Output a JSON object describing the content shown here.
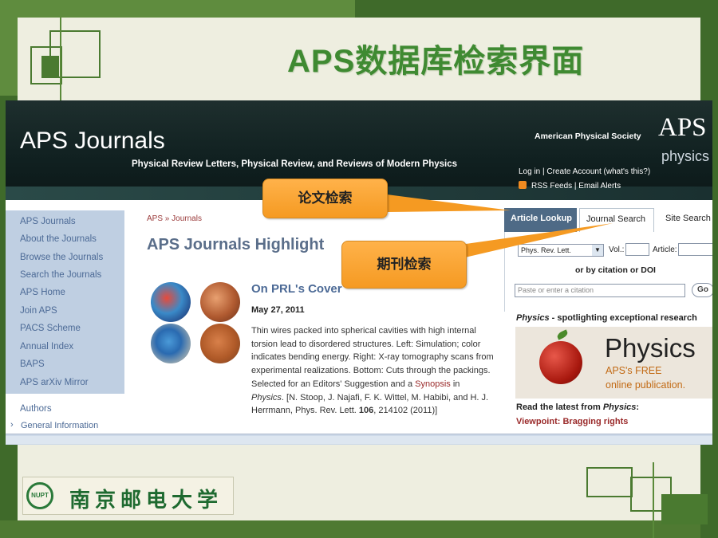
{
  "slide": {
    "title": "APS数据库检索界面",
    "university": "南京邮电大学",
    "seal_text": "NUPT"
  },
  "header": {
    "brand": "APS Journals",
    "tagline": "Physical Review Letters, Physical Review, and Reviews of Modern Physics",
    "society": "American Physical Society",
    "logo_aps": "APS",
    "logo_physics": "physics",
    "links_line1": "Log in  |  Create Account (what's this?)",
    "rss": "RSS Feeds",
    "email": "Email Alerts"
  },
  "sidebar": {
    "items": [
      {
        "label": "APS Journals"
      },
      {
        "label": "About the Journals"
      },
      {
        "label": "Browse the Journals"
      },
      {
        "label": "Search the Journals"
      },
      {
        "label": "APS Home"
      },
      {
        "label": "Join APS"
      },
      {
        "label": "PACS Scheme"
      },
      {
        "label": "Annual Index"
      },
      {
        "label": "BAPS"
      },
      {
        "label": "APS arXiv Mirror"
      }
    ],
    "authors": "Authors",
    "general_info": "General Information"
  },
  "main": {
    "breadcrumb_home": "APS",
    "breadcrumb_sep": "»",
    "breadcrumb_current": "Journals",
    "title": "APS Journals Highlight",
    "article_heading": "On PRL's Cover",
    "article_date": "May 27, 2011",
    "article_text1": "Thin wires packed into spherical cavities with high internal torsion lead to disordered structures. Left: Simulation; color indicates bending energy. Right: X-ray tomography scans from experimental realizations. Bottom: Cuts through the packings. Selected for an Editors' Suggestion and a ",
    "article_link": "Synopsis",
    "article_in": " in ",
    "article_physics": "Physics",
    "article_text2": ". [N. Stoop, J. Najafi, F. K. Wittel, M. Habibi, and H. J. Herrmann, Phys. Rev. Lett. ",
    "article_vol": "106",
    "article_text3": ", 214102 (2011)]"
  },
  "lookup": {
    "tabs": [
      "Article Lookup",
      "Journal Search",
      "Site Search"
    ],
    "journal_select": "Phys. Rev. Lett.",
    "vol_label": "Vol.:",
    "article_label": "Article:",
    "or_label": "or by citation or DOI",
    "citation_placeholder": "Paste or enter a citation",
    "go_label": "Go"
  },
  "physics_ad": {
    "intro_em": "Physics",
    "intro_rest": " - spotlighting exceptional research",
    "title": "Physics",
    "line1": "APS's FREE",
    "line2": "online publication.",
    "latest_prefix": "Read the latest from ",
    "latest_em": "Physics",
    "latest_suffix": ":",
    "viewpoint": "Viewpoint: Bragging rights"
  },
  "callouts": {
    "article_search": "论文检索",
    "journal_search": "期刊检索"
  },
  "colors": {
    "slide_green": "#3f6a2a",
    "callout_orange": "#f59a22",
    "header_dark": "#102020",
    "sidebar_blue": "#bfcfe2",
    "link_red": "#9a2a2a"
  }
}
